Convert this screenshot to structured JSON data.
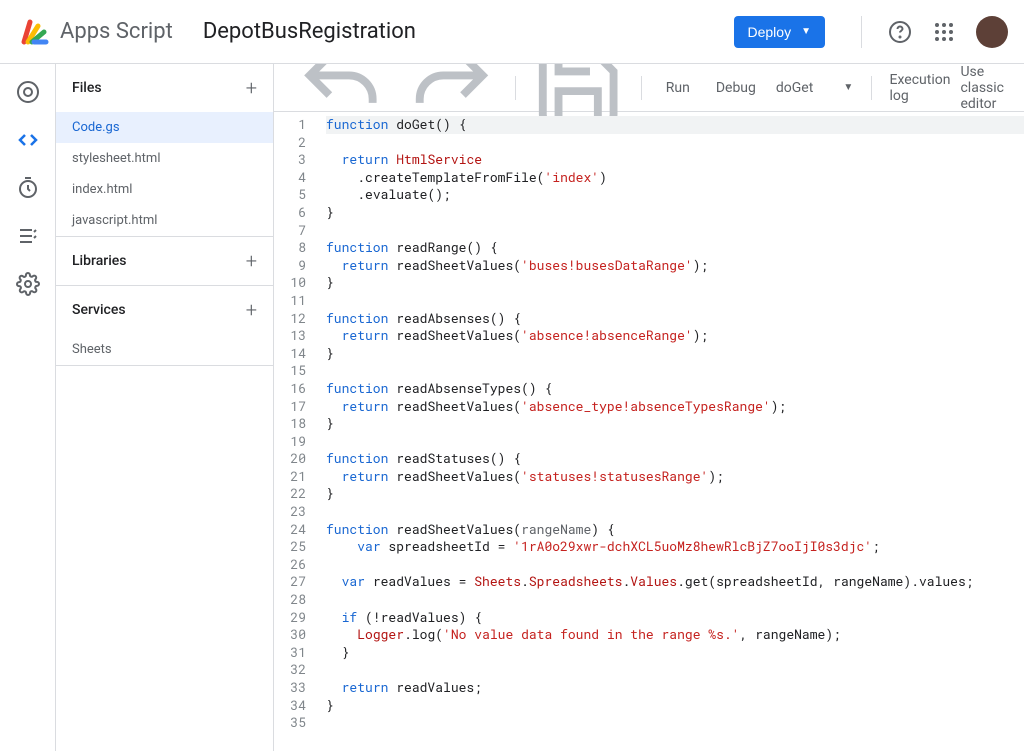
{
  "header": {
    "brand": "Apps Script",
    "project_name": "DepotBusRegistration",
    "deploy_label": "Deploy"
  },
  "toolbar": {
    "run_label": "Run",
    "debug_label": "Debug",
    "selected_function": "doGet",
    "execution_log_label": "Execution log",
    "classic_label": "Use classic editor"
  },
  "sidebar": {
    "files_label": "Files",
    "libraries_label": "Libraries",
    "services_label": "Services",
    "files": [
      {
        "name": "Code.gs",
        "selected": true
      },
      {
        "name": "stylesheet.html",
        "selected": false
      },
      {
        "name": "index.html",
        "selected": false
      },
      {
        "name": "javascript.html",
        "selected": false
      }
    ],
    "services": [
      {
        "name": "Sheets"
      }
    ]
  },
  "code": {
    "lines": [
      {
        "n": 1,
        "hl": true,
        "tokens": [
          [
            "kw",
            "function"
          ],
          [
            "pun",
            " "
          ],
          [
            "fn",
            "doGet"
          ],
          [
            "pun",
            "() {"
          ]
        ]
      },
      {
        "n": 2,
        "tokens": []
      },
      {
        "n": 3,
        "tokens": [
          [
            "pun",
            "  "
          ],
          [
            "kw",
            "return"
          ],
          [
            "pun",
            " "
          ],
          [
            "cls",
            "HtmlService"
          ]
        ]
      },
      {
        "n": 4,
        "tokens": [
          [
            "pun",
            "    ."
          ],
          [
            "fn",
            "createTemplateFromFile"
          ],
          [
            "pun",
            "("
          ],
          [
            "str",
            "'index'"
          ],
          [
            "pun",
            ")"
          ]
        ]
      },
      {
        "n": 5,
        "tokens": [
          [
            "pun",
            "    ."
          ],
          [
            "fn",
            "evaluate"
          ],
          [
            "pun",
            "();"
          ]
        ]
      },
      {
        "n": 6,
        "tokens": [
          [
            "pun",
            "}"
          ]
        ]
      },
      {
        "n": 7,
        "tokens": []
      },
      {
        "n": 8,
        "tokens": [
          [
            "kw",
            "function"
          ],
          [
            "pun",
            " "
          ],
          [
            "fn",
            "readRange"
          ],
          [
            "pun",
            "() {"
          ]
        ]
      },
      {
        "n": 9,
        "tokens": [
          [
            "pun",
            "  "
          ],
          [
            "kw",
            "return"
          ],
          [
            "pun",
            " "
          ],
          [
            "fn",
            "readSheetValues"
          ],
          [
            "pun",
            "("
          ],
          [
            "str",
            "'buses!busesDataRange'"
          ],
          [
            "pun",
            ");"
          ]
        ]
      },
      {
        "n": 10,
        "tokens": [
          [
            "pun",
            "}"
          ]
        ]
      },
      {
        "n": 11,
        "tokens": []
      },
      {
        "n": 12,
        "tokens": [
          [
            "kw",
            "function"
          ],
          [
            "pun",
            " "
          ],
          [
            "fn",
            "readAbsenses"
          ],
          [
            "pun",
            "() {"
          ]
        ]
      },
      {
        "n": 13,
        "tokens": [
          [
            "pun",
            "  "
          ],
          [
            "kw",
            "return"
          ],
          [
            "pun",
            " "
          ],
          [
            "fn",
            "readSheetValues"
          ],
          [
            "pun",
            "("
          ],
          [
            "str",
            "'absence!absenceRange'"
          ],
          [
            "pun",
            ");"
          ]
        ]
      },
      {
        "n": 14,
        "tokens": [
          [
            "pun",
            "}"
          ]
        ]
      },
      {
        "n": 15,
        "tokens": []
      },
      {
        "n": 16,
        "tokens": [
          [
            "kw",
            "function"
          ],
          [
            "pun",
            " "
          ],
          [
            "fn",
            "readAbsenseTypes"
          ],
          [
            "pun",
            "() {"
          ]
        ]
      },
      {
        "n": 17,
        "tokens": [
          [
            "pun",
            "  "
          ],
          [
            "kw",
            "return"
          ],
          [
            "pun",
            " "
          ],
          [
            "fn",
            "readSheetValues"
          ],
          [
            "pun",
            "("
          ],
          [
            "str",
            "'absence_type!absenceTypesRange'"
          ],
          [
            "pun",
            ");"
          ]
        ]
      },
      {
        "n": 18,
        "tokens": [
          [
            "pun",
            "}"
          ]
        ]
      },
      {
        "n": 19,
        "tokens": []
      },
      {
        "n": 20,
        "tokens": [
          [
            "kw",
            "function"
          ],
          [
            "pun",
            " "
          ],
          [
            "fn",
            "readStatuses"
          ],
          [
            "pun",
            "() {"
          ]
        ]
      },
      {
        "n": 21,
        "tokens": [
          [
            "pun",
            "  "
          ],
          [
            "kw",
            "return"
          ],
          [
            "pun",
            " "
          ],
          [
            "fn",
            "readSheetValues"
          ],
          [
            "pun",
            "("
          ],
          [
            "str",
            "'statuses!statusesRange'"
          ],
          [
            "pun",
            ");"
          ]
        ]
      },
      {
        "n": 22,
        "tokens": [
          [
            "pun",
            "}"
          ]
        ]
      },
      {
        "n": 23,
        "tokens": []
      },
      {
        "n": 24,
        "tokens": [
          [
            "kw",
            "function"
          ],
          [
            "pun",
            " "
          ],
          [
            "fn",
            "readSheetValues"
          ],
          [
            "pun",
            "("
          ],
          [
            "prop",
            "rangeName"
          ],
          [
            "pun",
            ") {"
          ]
        ]
      },
      {
        "n": 25,
        "tokens": [
          [
            "pun",
            "    "
          ],
          [
            "kw",
            "var"
          ],
          [
            "pun",
            " spreadsheetId = "
          ],
          [
            "str",
            "'1rA0o29xwr-dchXCL5uoMz8hewRlcBjZ7ooIjI0s3djc'"
          ],
          [
            "pun",
            ";"
          ]
        ]
      },
      {
        "n": 26,
        "tokens": []
      },
      {
        "n": 27,
        "tokens": [
          [
            "pun",
            "  "
          ],
          [
            "kw",
            "var"
          ],
          [
            "pun",
            " readValues = "
          ],
          [
            "cls",
            "Sheets"
          ],
          [
            "pun",
            "."
          ],
          [
            "cls",
            "Spreadsheets"
          ],
          [
            "pun",
            "."
          ],
          [
            "cls",
            "Values"
          ],
          [
            "pun",
            "."
          ],
          [
            "fn",
            "get"
          ],
          [
            "pun",
            "(spreadsheetId, rangeName).values;"
          ]
        ]
      },
      {
        "n": 28,
        "tokens": []
      },
      {
        "n": 29,
        "tokens": [
          [
            "pun",
            "  "
          ],
          [
            "kw",
            "if"
          ],
          [
            "pun",
            " (!readValues) {"
          ]
        ]
      },
      {
        "n": 30,
        "tokens": [
          [
            "pun",
            "    "
          ],
          [
            "cls",
            "Logger"
          ],
          [
            "pun",
            "."
          ],
          [
            "fn",
            "log"
          ],
          [
            "pun",
            "("
          ],
          [
            "str",
            "'No value data found in the range %s.'"
          ],
          [
            "pun",
            ", rangeName);"
          ]
        ]
      },
      {
        "n": 31,
        "tokens": [
          [
            "pun",
            "  }"
          ]
        ]
      },
      {
        "n": 32,
        "tokens": []
      },
      {
        "n": 33,
        "tokens": [
          [
            "pun",
            "  "
          ],
          [
            "kw",
            "return"
          ],
          [
            "pun",
            " readValues;"
          ]
        ]
      },
      {
        "n": 34,
        "tokens": [
          [
            "pun",
            "}"
          ]
        ]
      },
      {
        "n": 35,
        "tokens": []
      }
    ]
  }
}
